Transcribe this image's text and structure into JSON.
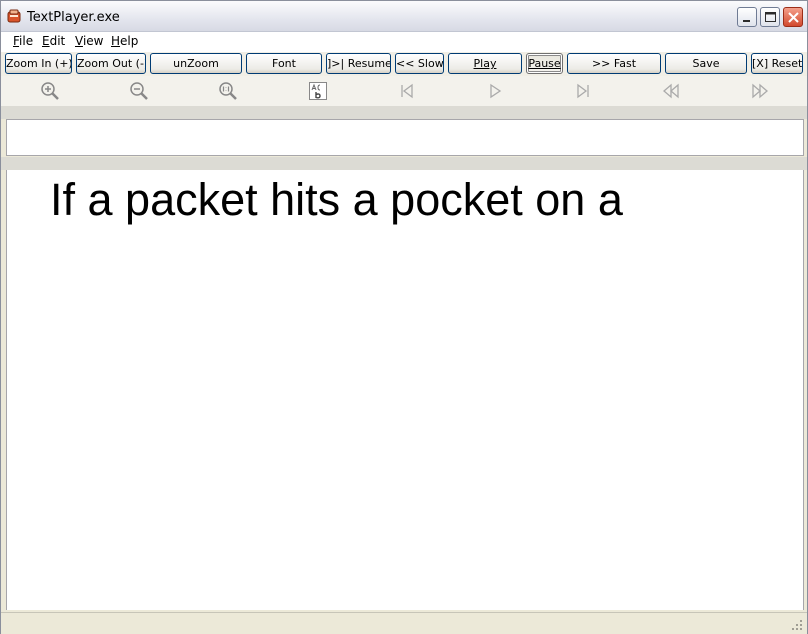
{
  "window": {
    "title": "TextPlayer.exe",
    "app_icon": "textplayer-app-icon"
  },
  "menu": {
    "file": {
      "hot": "F",
      "rest": "ile"
    },
    "edit": {
      "hot": "E",
      "rest": "dit"
    },
    "view": {
      "hot": "V",
      "rest": "iew"
    },
    "help": {
      "hot": "H",
      "rest": "elp"
    }
  },
  "buttons": {
    "zoom_in": "Zoom In (+)",
    "zoom_out": "Zoom Out (-)",
    "unzoom": "unZoom",
    "font": "Font",
    "resume": "]>| Resume",
    "slow": "<< Slow",
    "play": "Play",
    "pause": "Pause",
    "fast": ">> Fast",
    "save": "Save",
    "reset": "[X] Reset"
  },
  "icons": [
    "zoom-in-icon",
    "zoom-out-icon",
    "zoom-reset-icon",
    "font-icon",
    "skip-start-icon",
    "play-icon",
    "skip-end-icon",
    "rewind-icon",
    "fast-forward-icon"
  ],
  "input": {
    "value": ""
  },
  "display": {
    "text": "If a packet hits a pocket on a"
  },
  "colors": {
    "text": "#000000",
    "display_bg": "#ffffff",
    "window_bg": "#ece9d8",
    "close_button": "#d2492d"
  }
}
